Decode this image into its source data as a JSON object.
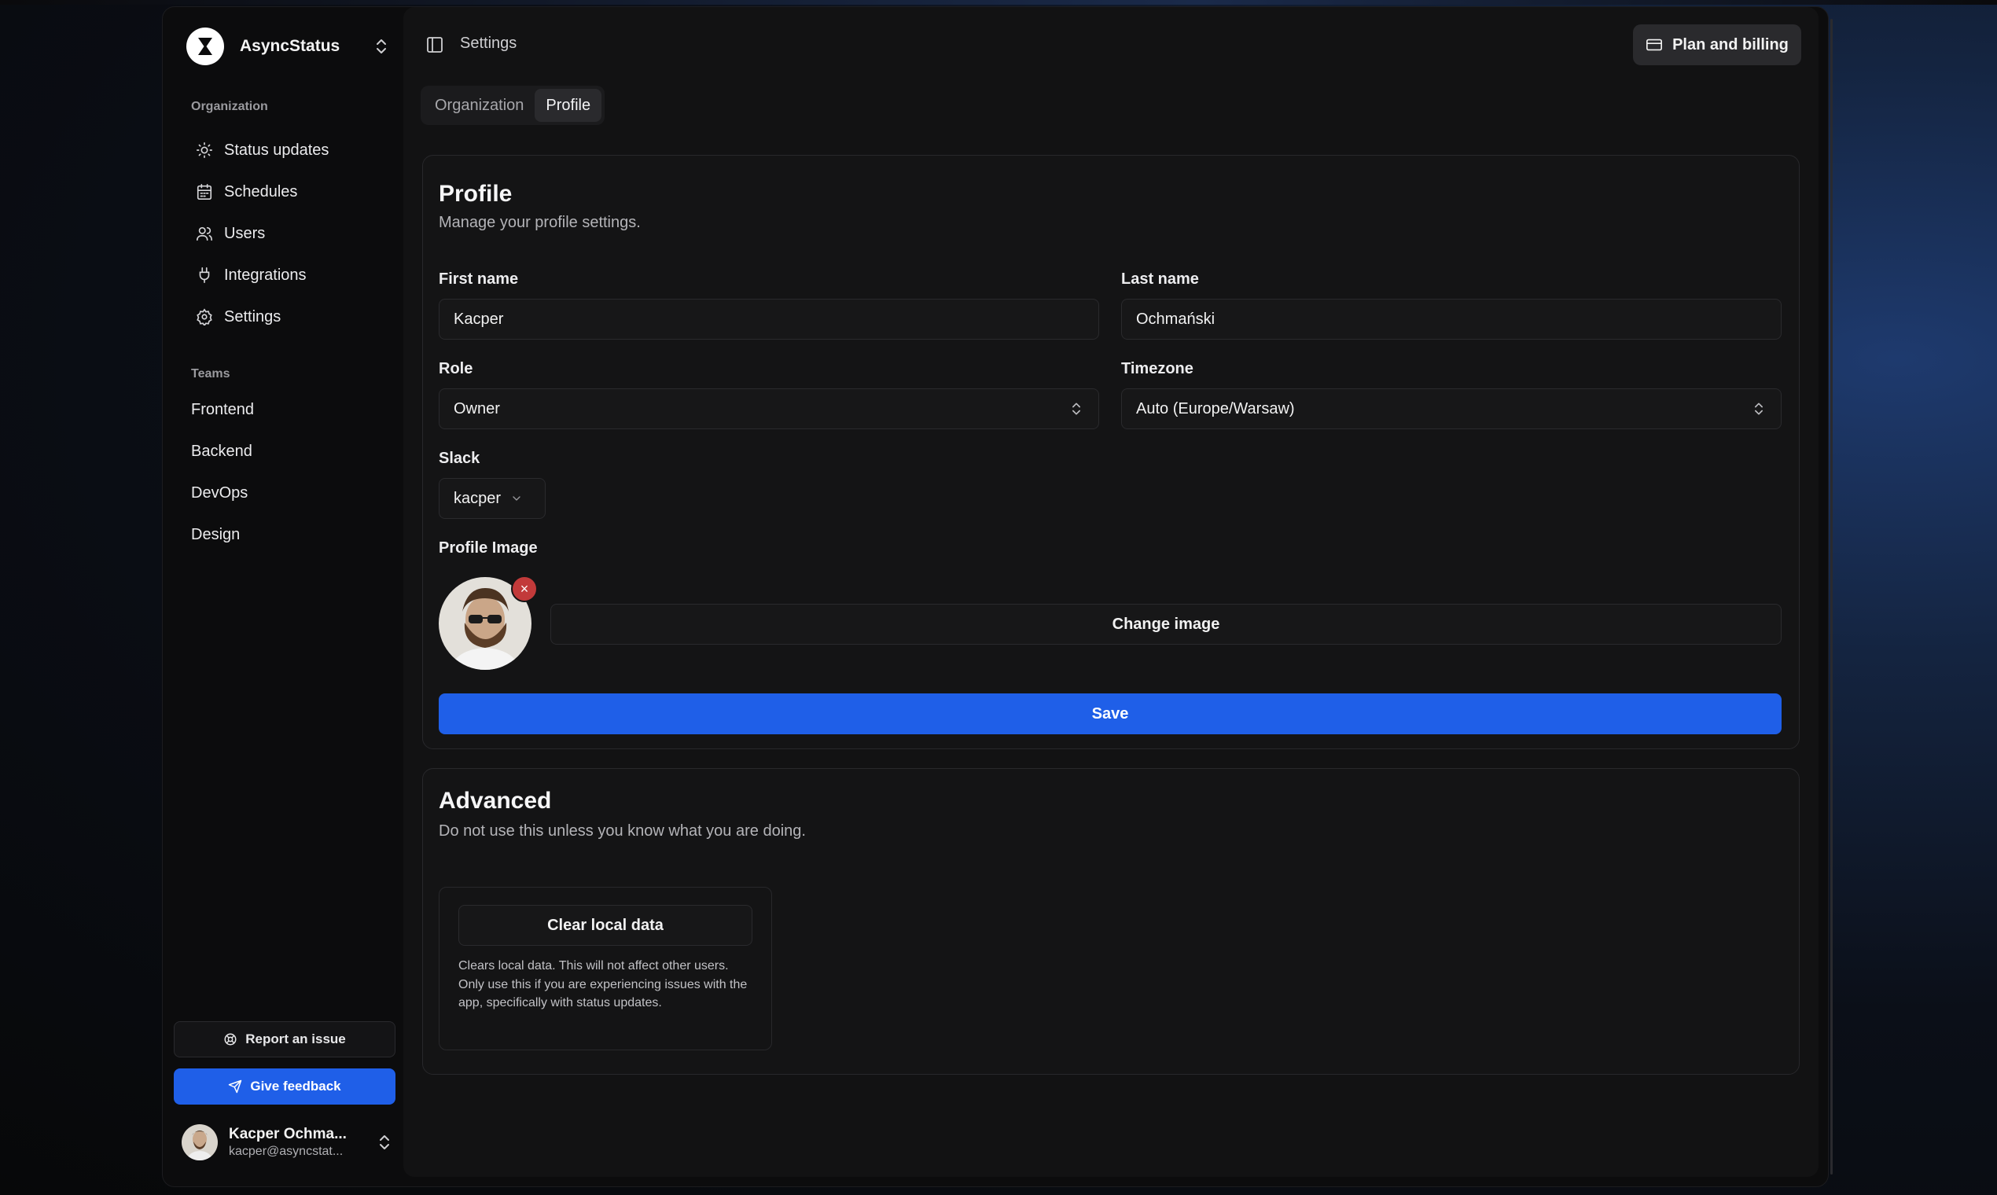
{
  "sidebar": {
    "org_name": "AsyncStatus",
    "organization_heading": "Organization",
    "nav": [
      {
        "label": "Status updates",
        "icon": "sun-icon"
      },
      {
        "label": "Schedules",
        "icon": "calendar-icon"
      },
      {
        "label": "Users",
        "icon": "users-icon"
      },
      {
        "label": "Integrations",
        "icon": "plug-icon"
      },
      {
        "label": "Settings",
        "icon": "gear-icon"
      }
    ],
    "teams_heading": "Teams",
    "teams": [
      "Frontend",
      "Backend",
      "DevOps",
      "Design"
    ],
    "report_label": "Report an issue",
    "feedback_label": "Give feedback",
    "user": {
      "name": "Kacper Ochma...",
      "email": "kacper@asyncstat..."
    }
  },
  "header": {
    "title": "Settings",
    "billing_label": "Plan and billing"
  },
  "tabs": [
    "Organization",
    "Profile"
  ],
  "active_tab": "Profile",
  "profile": {
    "title": "Profile",
    "description": "Manage your profile settings.",
    "first_name_label": "First name",
    "first_name_value": "Kacper",
    "last_name_label": "Last name",
    "last_name_value": "Ochmański",
    "role_label": "Role",
    "role_value": "Owner",
    "timezone_label": "Timezone",
    "timezone_value": "Auto (Europe/Warsaw)",
    "slack_label": "Slack",
    "slack_value": "kacper",
    "image_label": "Profile Image",
    "remove_symbol": "×",
    "change_image_label": "Change image",
    "save_label": "Save"
  },
  "advanced": {
    "title": "Advanced",
    "description": "Do not use this unless you know what you are doing.",
    "clear_label": "Clear local data",
    "clear_description": "Clears local data. This will not affect other users. Only use this if you are experiencing issues with the app, specifically with status updates."
  },
  "colors": {
    "accent": "#1f5fe8",
    "danger": "#c23a3a",
    "background": "#0c0c0d",
    "panel": "#121213"
  }
}
